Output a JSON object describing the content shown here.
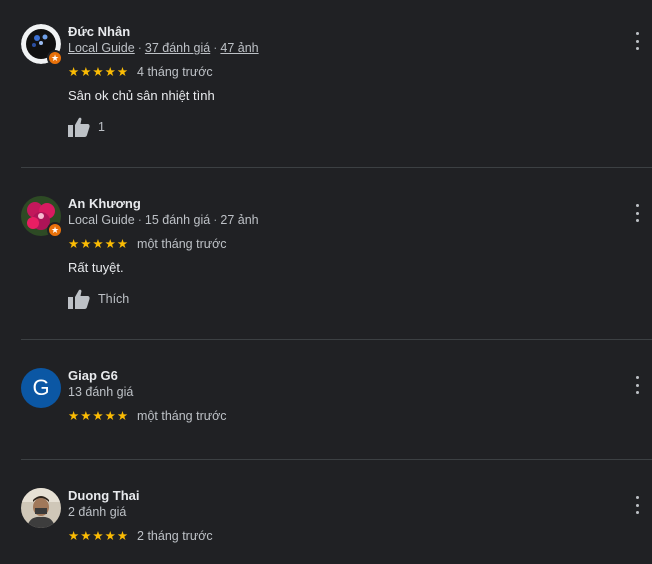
{
  "reviews": [
    {
      "name": "Đức Nhân",
      "meta": {
        "local_guide": "Local Guide",
        "reviews": "37 đánh giá",
        "photos": "47 ảnh"
      },
      "stars": "★★★★★",
      "time": "4 tháng trước",
      "text": "Sân ok chủ sân nhiệt tình",
      "like_label": "1"
    },
    {
      "name": "An Khương",
      "meta": {
        "local_guide": "Local Guide",
        "reviews": "15 đánh giá",
        "photos": "27 ảnh"
      },
      "stars": "★★★★★",
      "time": "một tháng trước",
      "text": "Rất tuyệt.",
      "like_label": "Thích"
    },
    {
      "name": "Giap G6",
      "avatar_letter": "G",
      "meta": {
        "reviews": "13 đánh giá"
      },
      "stars": "★★★★★",
      "time": "một tháng trước"
    },
    {
      "name": "Duong Thai",
      "meta": {
        "reviews": "2 đánh giá"
      },
      "stars": "★★★★★",
      "time": "2 tháng trước"
    }
  ],
  "badge_icon": "local-guide-star",
  "rating": 5,
  "colors": {
    "star": "#fbbc04",
    "badge": "#e8710a",
    "letter_avatar": "#0b57a4",
    "background": "#202124"
  }
}
